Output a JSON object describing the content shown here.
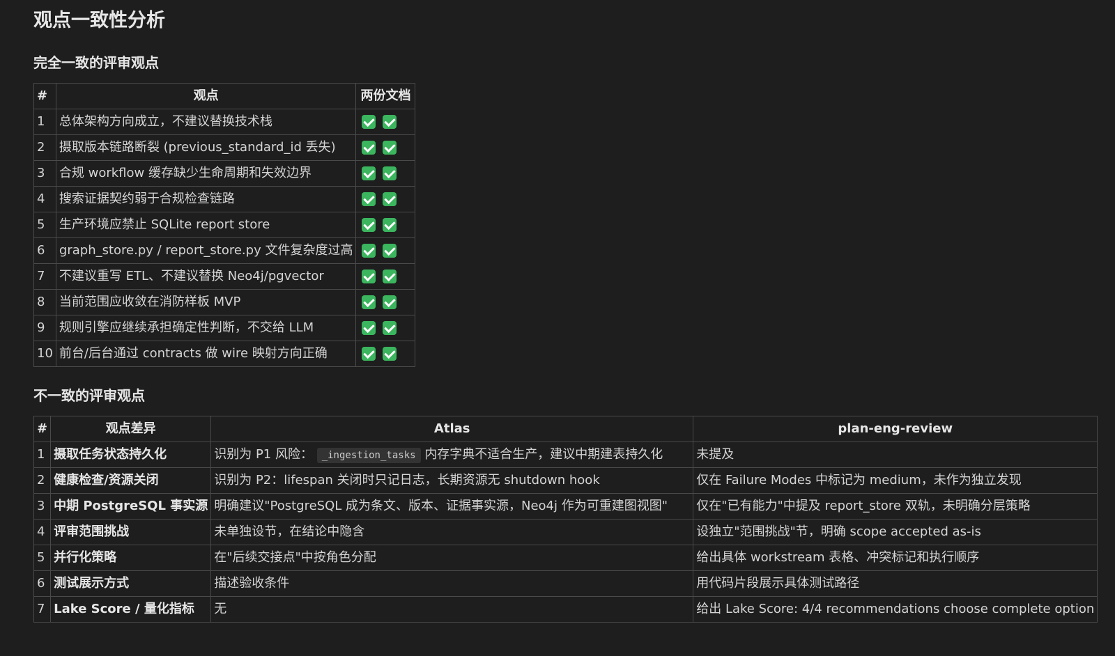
{
  "title": "观点一致性分析",
  "section_consistent": {
    "heading": "完全一致的评审观点",
    "headers": {
      "num": "#",
      "point": "观点",
      "both": "两份文档"
    },
    "rows": [
      {
        "num": "1",
        "point": "总体架构方向成立，不建议替换技术栈"
      },
      {
        "num": "2",
        "point": "摄取版本链路断裂 (previous_standard_id 丢失)"
      },
      {
        "num": "3",
        "point": "合规 workflow 缓存缺少生命周期和失效边界"
      },
      {
        "num": "4",
        "point": "搜索证据契约弱于合规检查链路"
      },
      {
        "num": "5",
        "point": "生产环境应禁止 SQLite report store"
      },
      {
        "num": "6",
        "point": "graph_store.py / report_store.py 文件复杂度过高"
      },
      {
        "num": "7",
        "point": "不建议重写 ETL、不建议替换 Neo4j/pgvector"
      },
      {
        "num": "8",
        "point": "当前范围应收敛在消防样板 MVP"
      },
      {
        "num": "9",
        "point": "规则引擎应继续承担确定性判断，不交给 LLM"
      },
      {
        "num": "10",
        "point": "前台/后台通过 contracts 做 wire 映射方向正确"
      }
    ]
  },
  "section_inconsistent": {
    "heading": "不一致的评审观点",
    "headers": {
      "num": "#",
      "diff": "观点差异",
      "atlas": "Atlas",
      "review": "plan-eng-review"
    },
    "rows": [
      {
        "num": "1",
        "diff": "摄取任务状态持久化",
        "atlas_pre": "识别为 P1 风险：",
        "atlas_code": "_ingestion_tasks",
        "atlas_post": "内存字典不适合生产，建议中期建表持久化",
        "review": "未提及"
      },
      {
        "num": "2",
        "diff": "健康检查/资源关闭",
        "atlas": "识别为 P2：lifespan 关闭时只记日志，长期资源无 shutdown hook",
        "review": "仅在 Failure Modes 中标记为 medium，未作为独立发现"
      },
      {
        "num": "3",
        "diff": "中期 PostgreSQL 事实源",
        "atlas": "明确建议\"PostgreSQL 成为条文、版本、证据事实源，Neo4j 作为可重建图视图\"",
        "review": "仅在\"已有能力\"中提及 report_store 双轨，未明确分层策略"
      },
      {
        "num": "4",
        "diff": "评审范围挑战",
        "atlas": "未单独设节，在结论中隐含",
        "review": "设独立\"范围挑战\"节，明确 scope accepted as-is"
      },
      {
        "num": "5",
        "diff": "并行化策略",
        "atlas": "在\"后续交接点\"中按角色分配",
        "review": "给出具体 workstream 表格、冲突标记和执行顺序"
      },
      {
        "num": "6",
        "diff": "测试展示方式",
        "atlas": "描述验收条件",
        "review": "用代码片段展示具体测试路径"
      },
      {
        "num": "7",
        "diff": "Lake Score / 量化指标",
        "atlas": "无",
        "review": "给出 Lake Score: 4/4 recommendations choose complete option"
      }
    ]
  }
}
